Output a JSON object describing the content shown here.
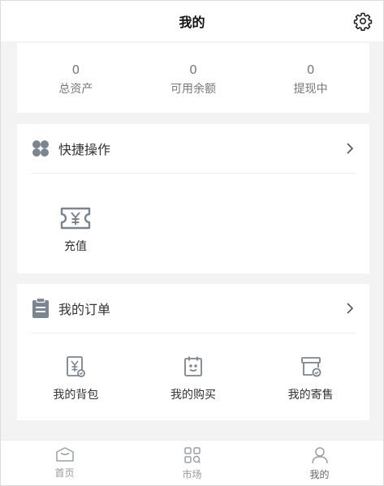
{
  "header": {
    "title": "我的",
    "settings_icon": "gear-icon"
  },
  "assets": [
    {
      "value": "0",
      "label": "总资产"
    },
    {
      "value": "0",
      "label": "可用余额"
    },
    {
      "value": "0",
      "label": "提现中"
    }
  ],
  "quick_actions": {
    "title": "快捷操作",
    "icon": "clover-icon",
    "items": [
      {
        "label": "充值",
        "icon": "recharge-yen-icon"
      }
    ]
  },
  "orders": {
    "title": "我的订单",
    "icon": "clipboard-icon",
    "items": [
      {
        "label": "我的背包",
        "icon": "backpack-icon"
      },
      {
        "label": "我的购买",
        "icon": "purchase-icon"
      },
      {
        "label": "我的寄售",
        "icon": "consign-icon"
      }
    ]
  },
  "tabbar": {
    "items": [
      {
        "label": "首页",
        "icon": "home-icon"
      },
      {
        "label": "市场",
        "icon": "market-grid-icon"
      },
      {
        "label": "我的",
        "icon": "user-icon",
        "active": true
      }
    ]
  },
  "colors": {
    "background": "#f3f3f3",
    "card": "#ffffff",
    "icon_gray": "#7a8591",
    "text": "#333333",
    "muted": "#999999"
  }
}
